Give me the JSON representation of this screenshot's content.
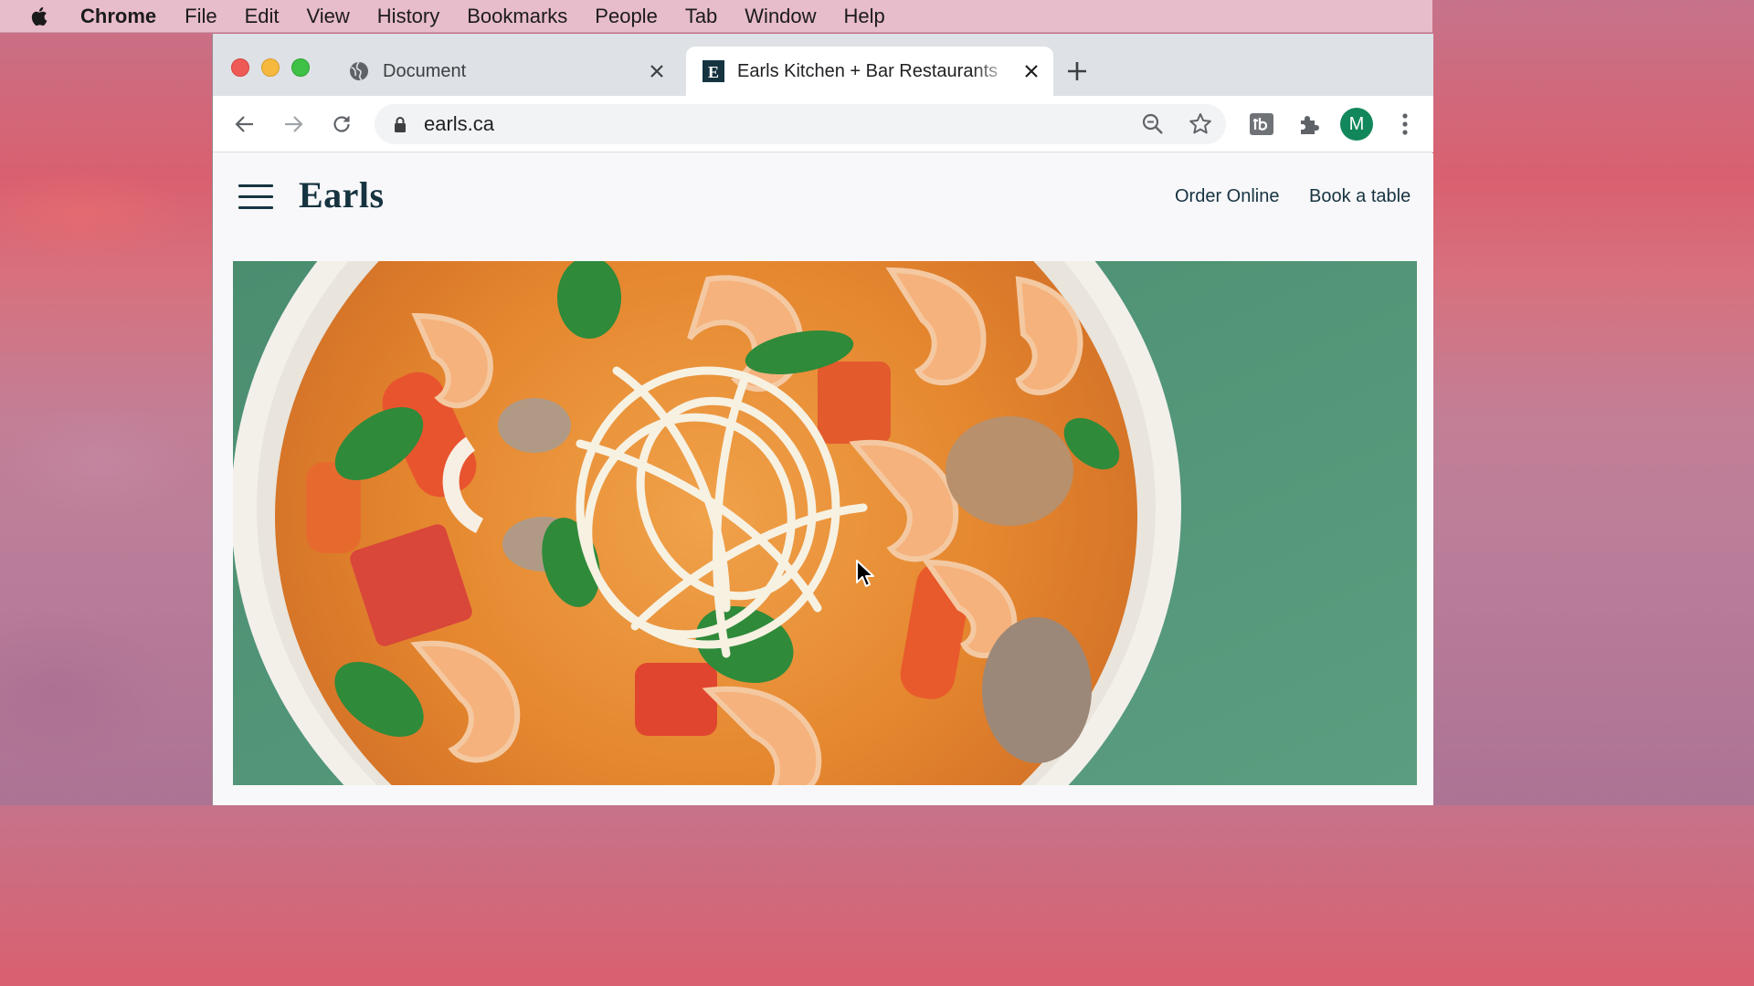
{
  "menubar": {
    "app_name": "Chrome",
    "items": [
      "File",
      "Edit",
      "View",
      "History",
      "Bookmarks",
      "People",
      "Tab",
      "Window",
      "Help"
    ]
  },
  "browser": {
    "tabs": [
      {
        "title": "Document",
        "favicon": "globe-icon",
        "active": false
      },
      {
        "title": "Earls Kitchen + Bar Restaurants",
        "favicon": "earls-e-icon",
        "favicon_letter": "E",
        "active": true
      }
    ],
    "url": "earls.ca",
    "profile_initial": "M",
    "colors": {
      "profile": "#11875b",
      "tabstrip": "#dee1e6"
    }
  },
  "site": {
    "logo": "Earls",
    "nav": {
      "order_online": "Order Online",
      "book_table": "Book a table"
    },
    "hero_image": "bowl of shrimp curry with shaved fennel, basil and tomatoes on a green background",
    "colors": {
      "brand": "#163340",
      "hero_background": "#4d9275"
    }
  }
}
